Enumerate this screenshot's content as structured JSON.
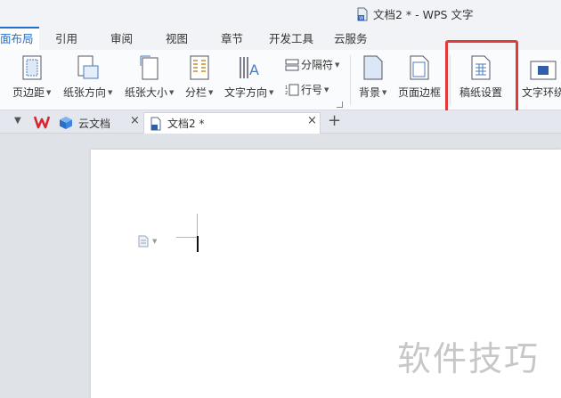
{
  "window": {
    "title": "文档2 * - WPS 文字"
  },
  "menu": {
    "tabs": [
      "面布局",
      "引用",
      "审阅",
      "视图",
      "章节",
      "开发工具",
      "云服务"
    ]
  },
  "ribbon": {
    "margins": "页边距",
    "orientation": "纸张方向",
    "size": "纸张大小",
    "columns": "分栏",
    "text_direction": "文字方向",
    "breaks": "分隔符",
    "line_numbers": "行号",
    "background": "背景",
    "page_border": "页面边框",
    "manuscript": "稿纸设置",
    "text_wrap": "文字环绕"
  },
  "tabs": {
    "cloud_docs": "云文档",
    "current_doc": "文档2 *",
    "close_glyph": "×",
    "new_tab_glyph": "+"
  },
  "watermark": "软件技巧",
  "colors": {
    "accent": "#1f6fd0",
    "highlight": "#e03b3b"
  }
}
